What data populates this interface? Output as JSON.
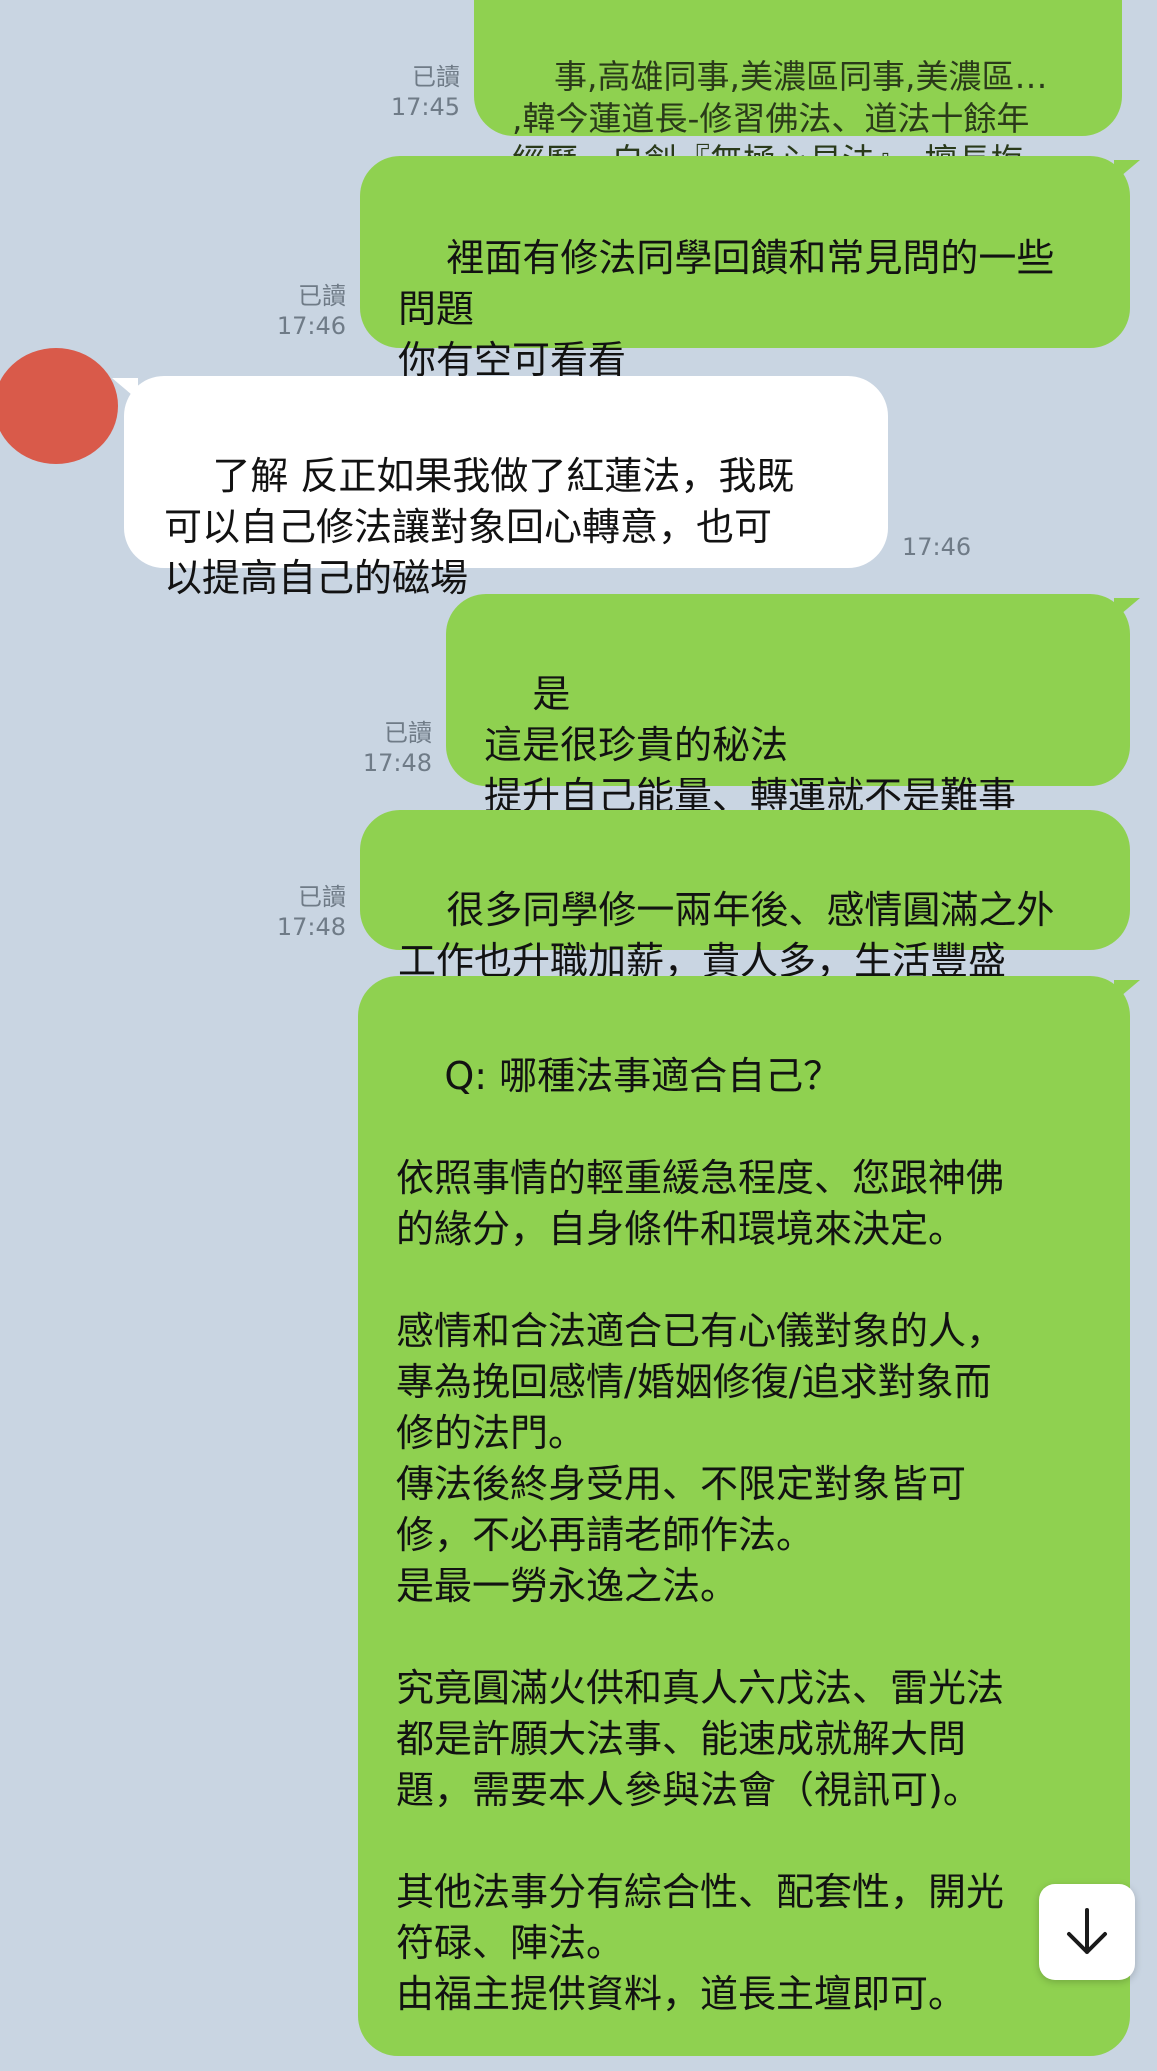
{
  "chat": {
    "messages": [
      {
        "id": "m1",
        "side": "out",
        "text": "事,高雄同事,美濃區同事,美濃區…\n,韓今蓮道長-修習佛法、道法十餘年\n經歷，自創『無極心易法』，擅長梅…",
        "read": "已讀",
        "time": "17:45"
      },
      {
        "id": "m2",
        "side": "out",
        "text": "裡面有修法同學回饋和常見問的一些\n問題\n你有空可看看",
        "read": "已讀",
        "time": "17:46"
      },
      {
        "id": "m3",
        "side": "in",
        "text": "了解 反正如果我做了紅蓮法，我既\n可以自己修法讓對象回心轉意，也可\n以提高自己的磁場",
        "time": "17:46"
      },
      {
        "id": "m4",
        "side": "out",
        "text": "是\n這是很珍貴的秘法\n提升自己能量、轉運就不是難事",
        "read": "已讀",
        "time": "17:48"
      },
      {
        "id": "m5",
        "side": "out",
        "text": "很多同學修一兩年後、感情圓滿之外\n工作也升職加薪，貴人多，生活豐盛",
        "read": "已讀",
        "time": "17:48"
      },
      {
        "id": "m6",
        "side": "out",
        "text": "Q: 哪種法事適合自己？\n\n依照事情的輕重緩急程度、您跟神佛\n的緣分，自身條件和環境來決定。\n\n感情和合法適合已有心儀對象的人，\n專為挽回感情/婚姻修復/追求對象而\n修的法門。\n傳法後終身受用、不限定對象皆可\n修，不必再請老師作法。\n是最一勞永逸之法。\n\n究竟圓滿火供和真人六戊法、雷光法\n都是許願大法事、能速成就解大問\n題，需要本人參與法會（視訊可)。\n\n其他法事分有綜合性、配套性，開光\n符碌、陣法。\n由福主提供資料，道長主壇即可。"
      }
    ]
  },
  "scroll_button": {
    "icon": "arrow-down-icon"
  }
}
